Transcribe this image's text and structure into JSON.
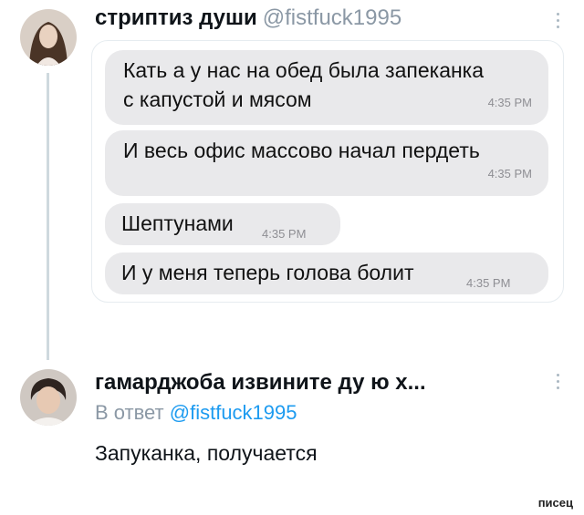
{
  "tweet": {
    "author_name": "стриптиз души",
    "author_handle": "@fistfuck1995",
    "messages": [
      {
        "line1": "Кать а у нас на обед была запеканка",
        "line2": "с капустой и мясом",
        "time": "4:35 PM"
      },
      {
        "line1": "И весь офис массово начал пердеть",
        "time": "4:35 PM"
      },
      {
        "line1": "Шептунами",
        "time": "4:35 PM"
      },
      {
        "line1": "И у меня теперь голова болит",
        "time": "4:35 PM"
      }
    ]
  },
  "reply": {
    "author_name": "гамарджоба извините ду ю х...",
    "reply_prefix": "В ответ",
    "reply_to": "@fistfuck1995",
    "text": "Запуканка, получается"
  },
  "watermark": "писец",
  "icons": {
    "more": "more-vertical-icon"
  },
  "colors": {
    "bubble": "#e9e9eb",
    "mention": "#1d9bf0",
    "muted": "#8b98a5"
  }
}
